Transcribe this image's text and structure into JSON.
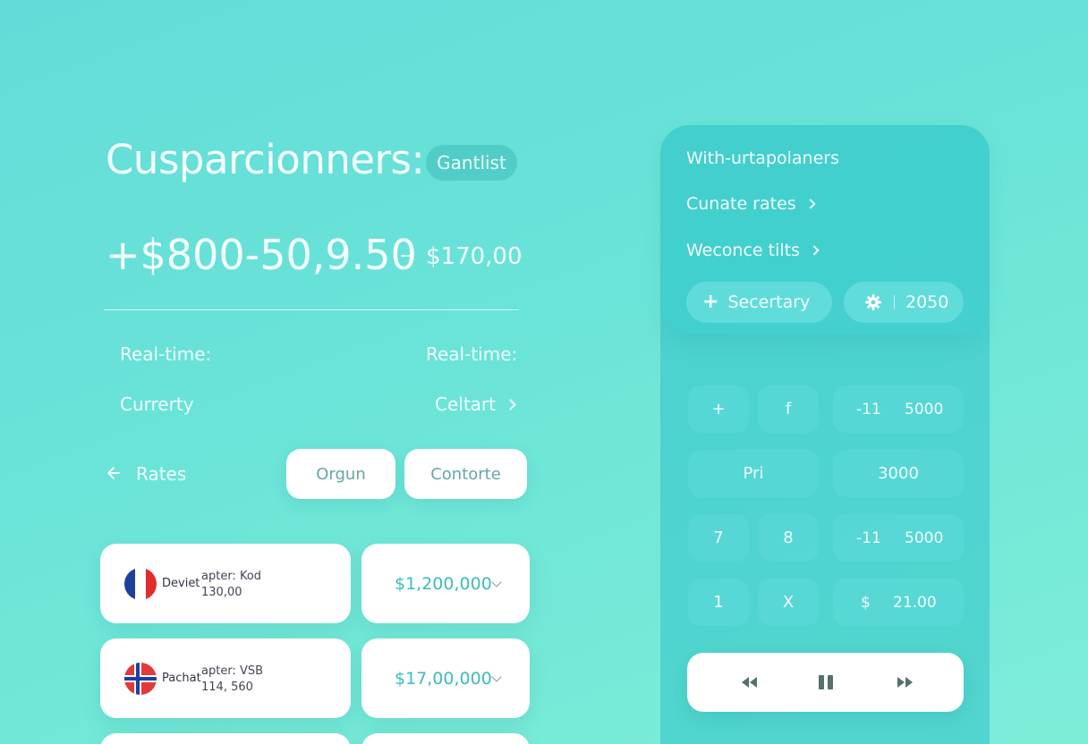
{
  "header": {
    "title": "Cusparcionners:",
    "badge": "Gantlist",
    "amount_primary": "+$800-50,9.50",
    "amount_separator": "–",
    "amount_secondary": "$170,00"
  },
  "info": {
    "row1_left": "Real-time:",
    "row1_right": "Real-time:",
    "row2_left": "Currerty",
    "row2_right": "Celtart"
  },
  "nav": {
    "back_label": "Rates",
    "button1": "Orgun",
    "button2": "Contorte"
  },
  "cards": [
    {
      "flag": "france-flag",
      "name": "Deviet",
      "line1": "apter: Kod",
      "line2": "130,00",
      "value": "$1,200,000"
    },
    {
      "flag": "norway-flag",
      "name": "Pachat",
      "line1": "apter: VSB",
      "line2": "114, 560",
      "value": "$17,00,000"
    }
  ],
  "panel": {
    "heading": "With-urtapolaners",
    "link1": "Cunate rates",
    "link2": "Weconce tilts",
    "pill_add": "Secertary",
    "pill_year": "2050"
  },
  "keypad": {
    "k_plus": "+",
    "k_f": "f",
    "k_r1_left": "-11",
    "k_r1_right": "5000",
    "k_pri": "Pri",
    "k_3000": "3000",
    "k_7": "7",
    "k_8": "8",
    "k_r3_left": "-11",
    "k_r3_right": "5000",
    "k_1": "1",
    "k_x": "X",
    "k_r4_left": "$",
    "k_r4_right": "21.00"
  },
  "media": {
    "icons": [
      "rewind-icon",
      "pause-icon",
      "fast-forward-icon"
    ]
  },
  "colors": {
    "accent": "#3cbcb8",
    "background": "#62dcd8",
    "panel": "#3ac3c8"
  }
}
